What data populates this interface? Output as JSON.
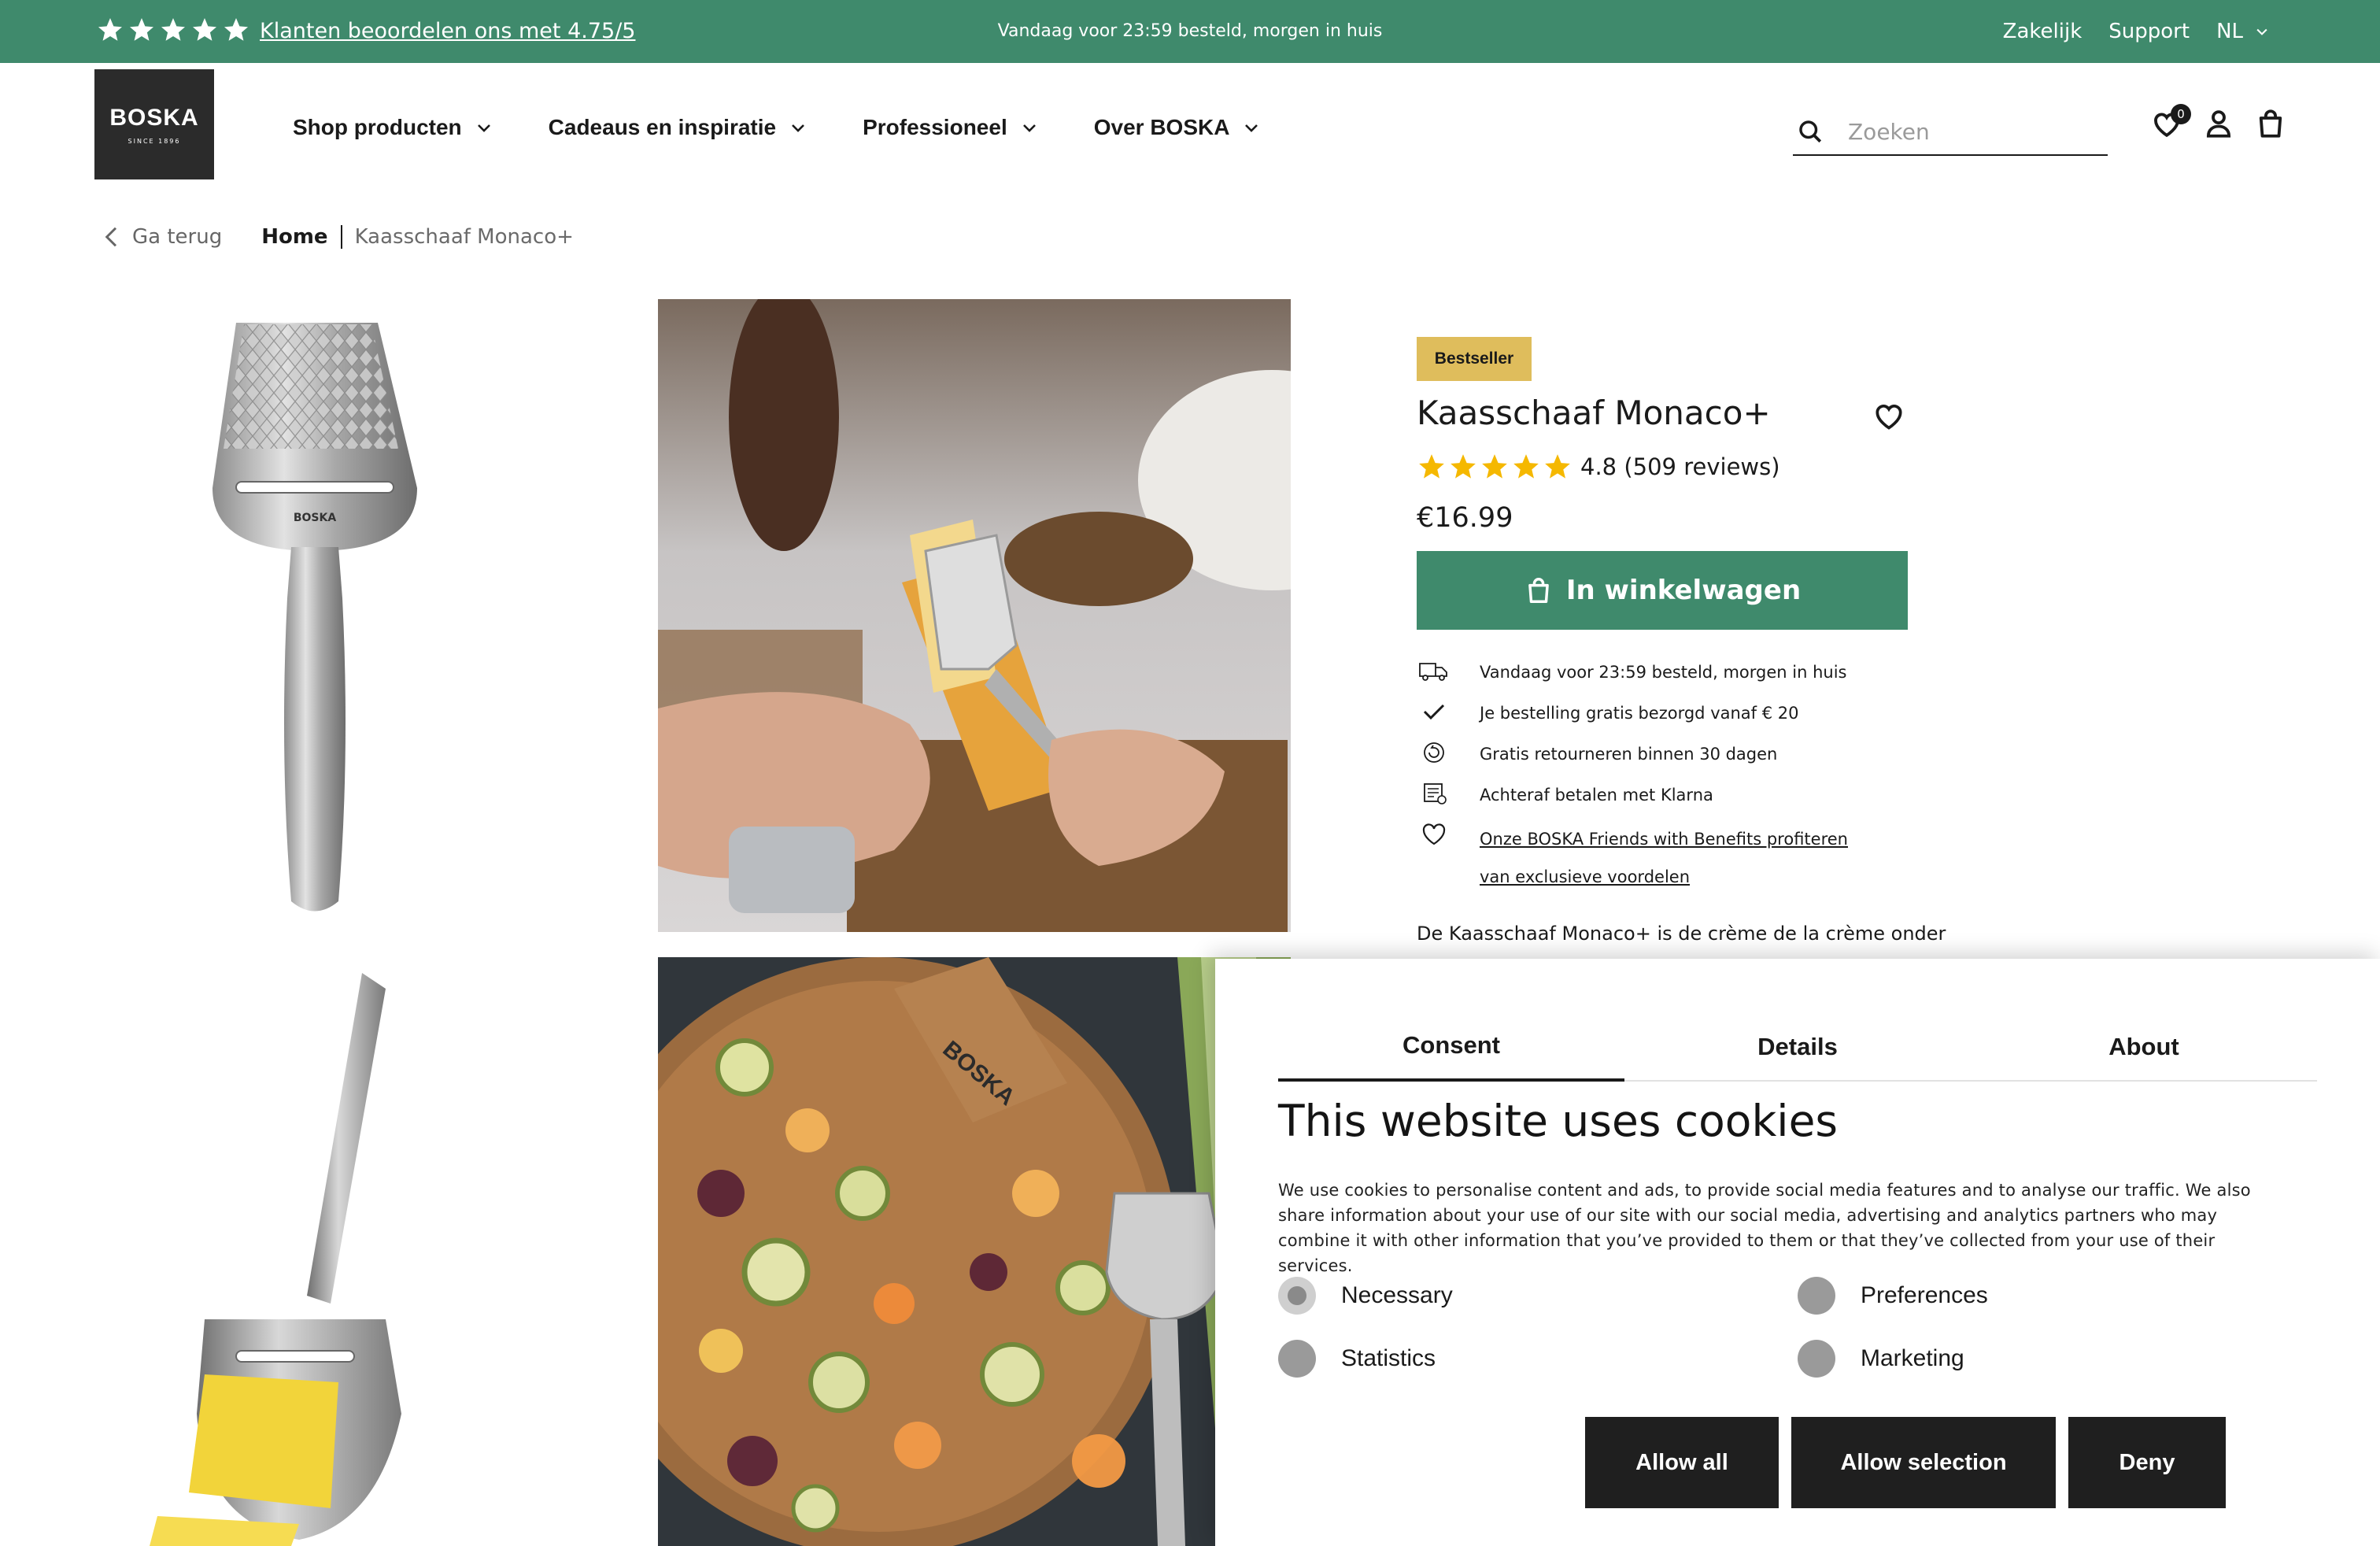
{
  "topbar": {
    "rating_link": "Klanten beoordelen ons met 4.75/5",
    "delivery": "Vandaag voor 23:59 besteld, morgen in huis",
    "business": "Zakelijk",
    "support": "Support",
    "language": "NL"
  },
  "header": {
    "logo_brand": "BOSKA",
    "logo_since": "SINCE 1896",
    "nav": [
      "Shop producten",
      "Cadeaus en inspiratie",
      "Professioneel",
      "Over BOSKA"
    ],
    "search_placeholder": "Zoeken",
    "wishlist_count": "0"
  },
  "breadcrumb": {
    "back": "Ga terug",
    "home": "Home",
    "current": "Kaasschaaf Monaco+"
  },
  "product": {
    "badge": "Bestseller",
    "title": "Kaasschaaf Monaco+",
    "rating": 4.8,
    "reviews_text": "4.8 (509 reviews)",
    "price": "€16.99",
    "add_to_cart": "In winkelwagen",
    "usps": [
      {
        "icon": "delivery-truck-icon",
        "text": "Vandaag voor 23:59 besteld, morgen in huis"
      },
      {
        "icon": "checkmark-icon",
        "text": "Je bestelling gratis bezorgd vanaf € 20"
      },
      {
        "icon": "return-icon",
        "text": "Gratis retourneren binnen 30 dagen"
      },
      {
        "icon": "invoice-icon",
        "text": "Achteraf betalen met Klarna"
      },
      {
        "icon": "heart-icon",
        "text": "Onze BOSKA Friends with Benefits profiteren van exclusieve voordelen"
      }
    ],
    "description_start": "De Kaasschaaf Monaco+ is de crème de la crème onder"
  },
  "cookie": {
    "tabs": [
      "Consent",
      "Details",
      "About"
    ],
    "active_tab": "Consent",
    "title": "This website uses cookies",
    "text": "We use cookies to personalise content and ads, to provide social media features and to analyse our traffic. We also share information about your use of our site with our social media, advertising and analytics partners who may combine it with other information that you’ve provided to them or that they’ve collected from your use of their services.",
    "options": [
      "Necessary",
      "Preferences",
      "Statistics",
      "Marketing"
    ],
    "buttons": {
      "allow_all": "Allow all",
      "allow_selection": "Allow selection",
      "deny": "Deny"
    }
  },
  "colors": {
    "brand_green": "#3f8a6c",
    "star_yellow": "#f5b800",
    "badge_gold": "#dfbd5c",
    "button_dark": "#1f1f1f"
  }
}
